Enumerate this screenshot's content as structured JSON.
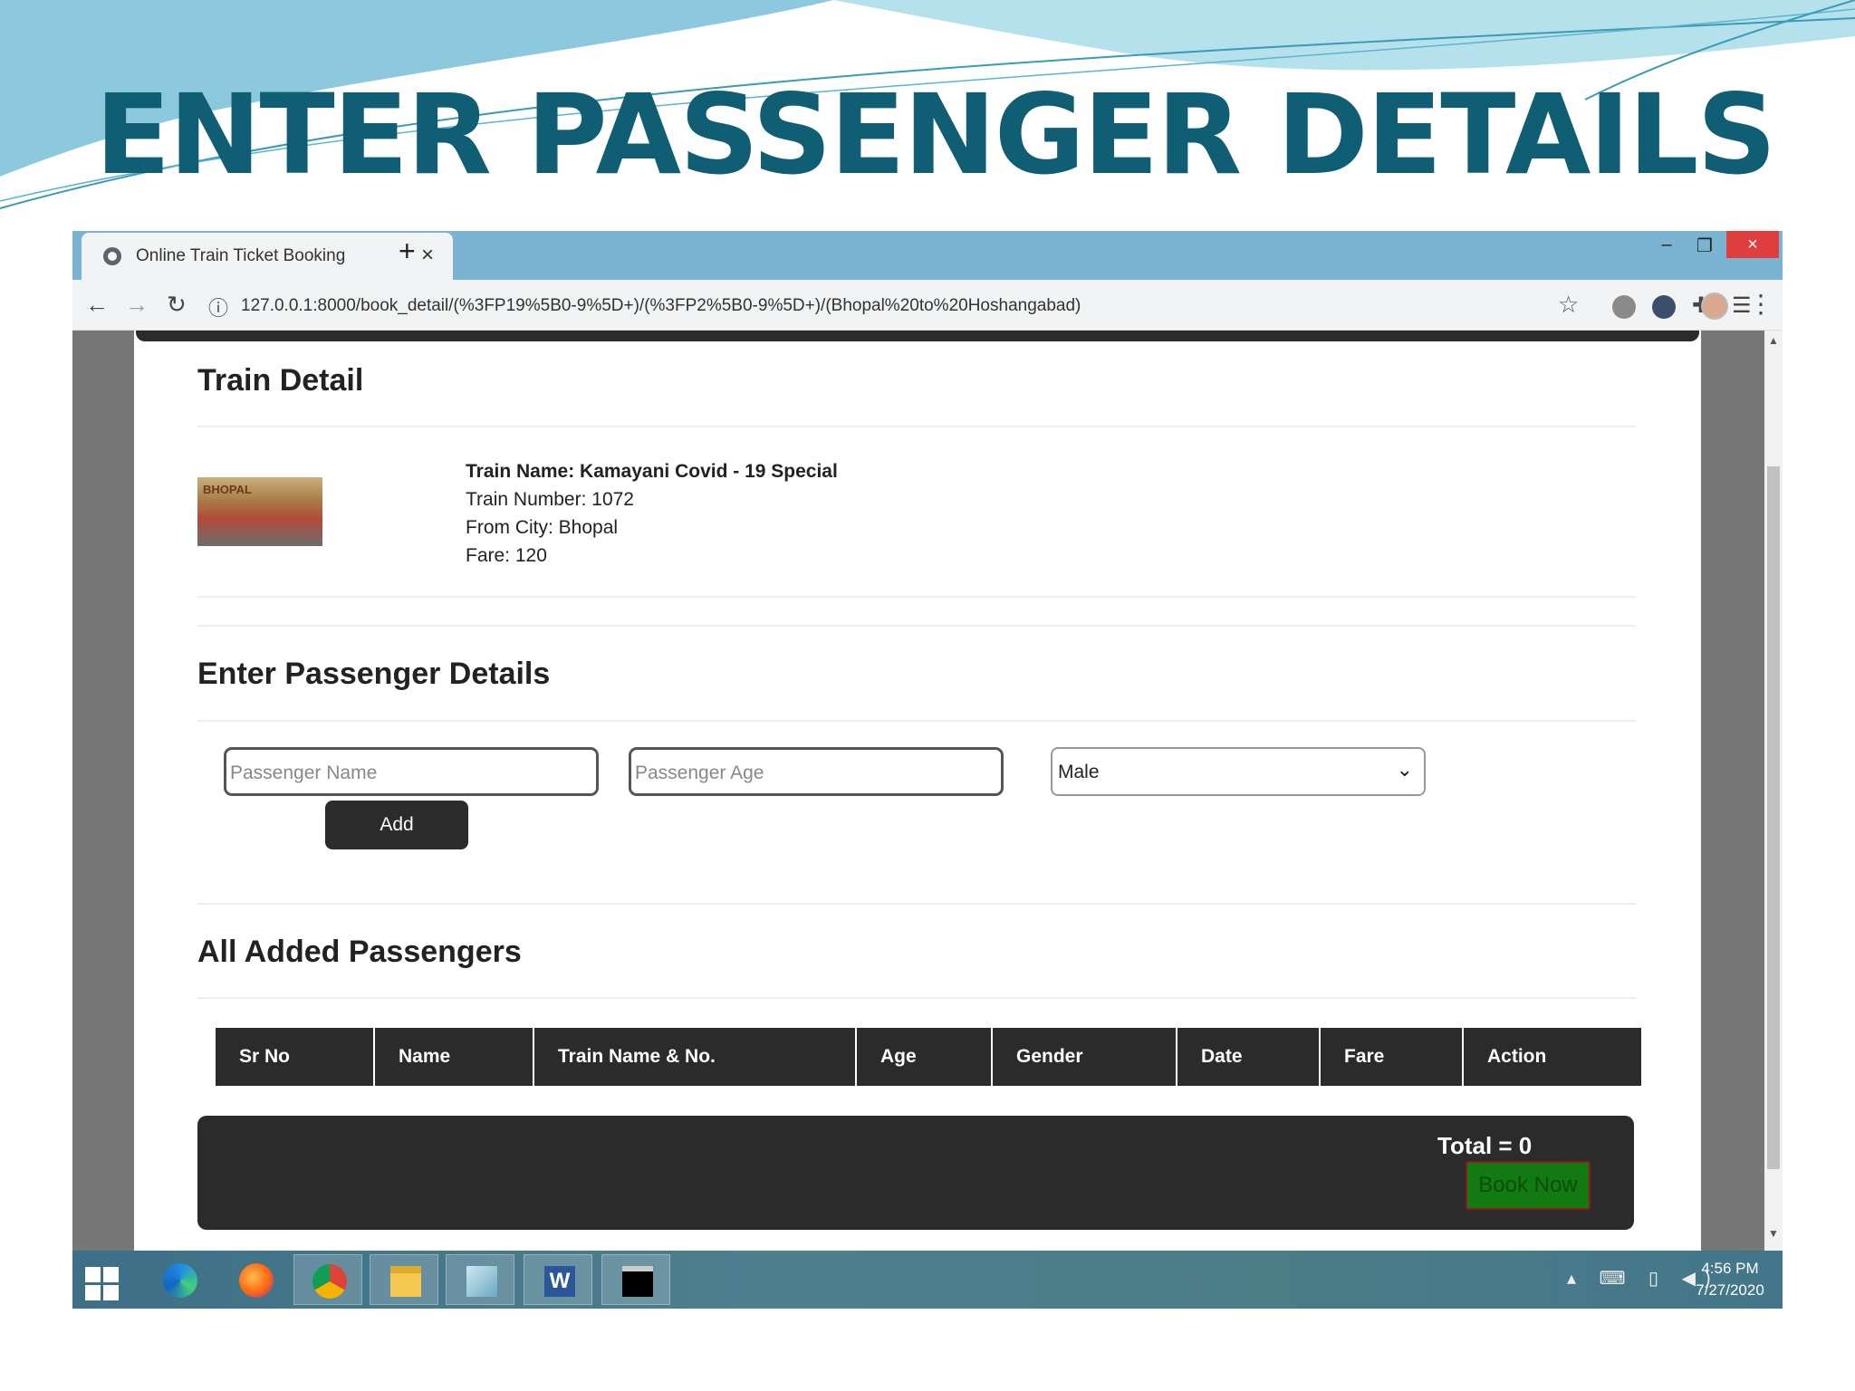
{
  "slide": {
    "title": "ENTER PASSENGER DETAILS"
  },
  "browser": {
    "tab_title": "Online Train Ticket Booking",
    "tab_close": "×",
    "new_tab": "+",
    "window_min": "–",
    "window_max": "❐",
    "window_close": "×",
    "url": "127.0.0.1:8000/book_detail/(%3FP19%5B0-9%5D+)/(%3FP2%5B0-9%5D+)/(Bhopal%20to%20Hoshangabad)"
  },
  "train_detail": {
    "heading": "Train Detail",
    "name": "Train Name: Kamayani Covid - 19 Special",
    "number": "Train Number: 1072",
    "from_city": "From City: Bhopal",
    "fare": "Fare: 120"
  },
  "passenger_form": {
    "heading": "Enter Passenger Details",
    "name_placeholder": "Passenger Name",
    "age_placeholder": "Passenger Age",
    "gender_selected": "Male",
    "add_label": "Add"
  },
  "passengers": {
    "heading": "All Added Passengers",
    "columns": [
      "Sr No",
      "Name",
      "Train Name & No.",
      "Age",
      "Gender",
      "Date",
      "Fare",
      "Action"
    ]
  },
  "summary": {
    "total": "Total = 0",
    "book_label": "Book Now"
  },
  "taskbar": {
    "time": "4:56 PM",
    "date": "7/27/2020"
  },
  "colors": {
    "title": "#0f5e74",
    "tabbar": "#7ab4d2",
    "dark": "#2b2b2b",
    "book_button": "#137a13",
    "close_button": "#e03e3e"
  }
}
